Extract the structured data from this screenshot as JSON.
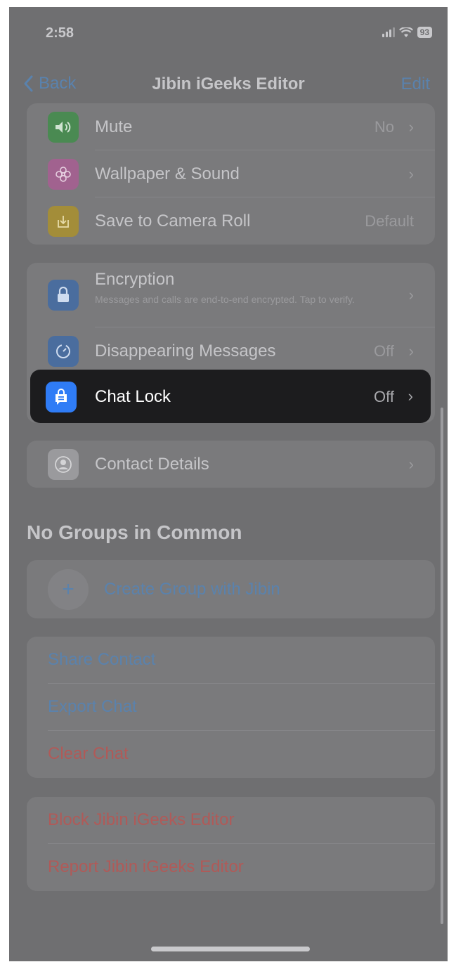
{
  "status_bar": {
    "time": "2:58",
    "battery": "93"
  },
  "nav": {
    "back_label": "Back",
    "title": "Jibin iGeeks Editor",
    "edit_label": "Edit"
  },
  "settings_group_1": [
    {
      "label": "Mute",
      "value": "No",
      "icon": "speaker-icon",
      "icon_color": "#4a8a52"
    },
    {
      "label": "Wallpaper & Sound",
      "value": "",
      "icon": "flower-icon",
      "icon_color": "#a1628f"
    },
    {
      "label": "Save to Camera Roll",
      "value": "Default",
      "icon": "download-icon",
      "icon_color": "#a38d39"
    }
  ],
  "settings_group_2": {
    "encryption": {
      "label": "Encryption",
      "subtitle": "Messages and calls are end-to-end encrypted. Tap to verify.",
      "icon": "lock-icon",
      "icon_color": "#4a6d9e"
    },
    "disappearing": {
      "label": "Disappearing Messages",
      "value": "Off",
      "icon": "timer-icon",
      "icon_color": "#4a6d9e"
    },
    "chat_lock": {
      "label": "Chat Lock",
      "value": "Off",
      "icon": "chat-lock-icon",
      "icon_color": "#2f7cf6"
    }
  },
  "contact_details": {
    "label": "Contact Details",
    "icon": "person-icon"
  },
  "groups": {
    "header": "No Groups in Common",
    "create_label": "Create Group with Jibin"
  },
  "actions": {
    "share": "Share Contact",
    "export": "Export Chat",
    "clear": "Clear Chat"
  },
  "danger": {
    "block": "Block Jibin iGeeks Editor",
    "report": "Report Jibin iGeeks Editor"
  },
  "colors": {
    "link": "#5a82ad",
    "destructive": "#b05a58",
    "highlight_bg": "#1c1c1e"
  }
}
